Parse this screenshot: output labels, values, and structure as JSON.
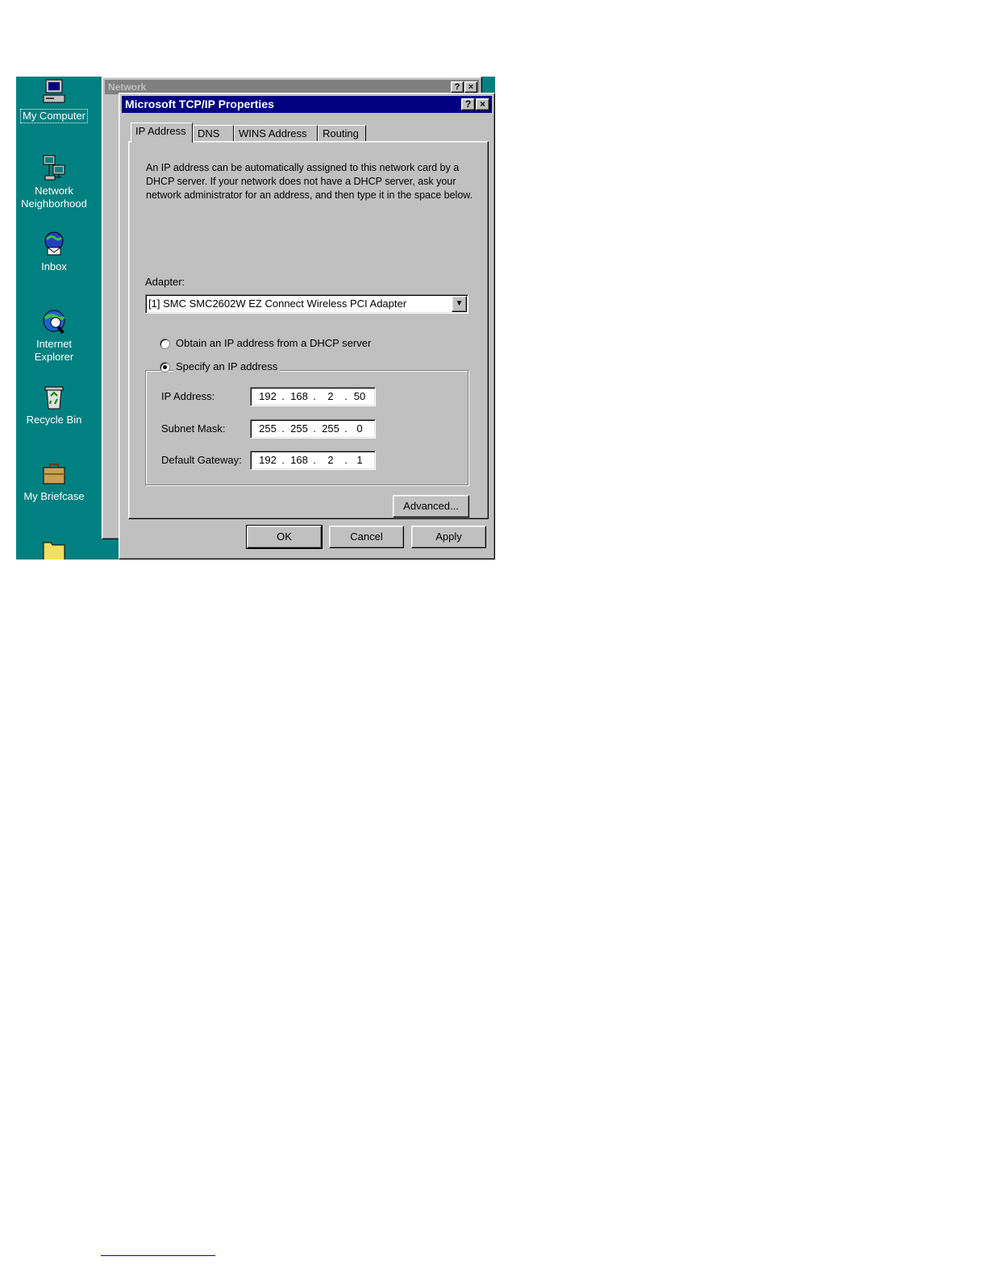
{
  "desktop": {
    "background_color": "#008080",
    "icons": [
      {
        "label": "My Computer",
        "icon": "my-computer-icon"
      },
      {
        "label": "Network Neighborhood",
        "icon": "network-neighborhood-icon"
      },
      {
        "label": "Inbox",
        "icon": "inbox-icon"
      },
      {
        "label": "Internet Explorer",
        "icon": "internet-explorer-icon"
      },
      {
        "label": "Recycle Bin",
        "icon": "recycle-bin-icon"
      },
      {
        "label": "My Briefcase",
        "icon": "briefcase-icon"
      },
      {
        "label": "",
        "icon": "folder-icon"
      }
    ]
  },
  "network_window": {
    "title": "Network",
    "help_button": "?",
    "close_button": "×"
  },
  "dialog": {
    "title": "Microsoft TCP/IP Properties",
    "help_button": "?",
    "close_button": "×",
    "tabs": [
      {
        "label": "IP Address",
        "active": true
      },
      {
        "label": "DNS",
        "active": false
      },
      {
        "label": "WINS Address",
        "active": false
      },
      {
        "label": "Routing",
        "active": false
      }
    ],
    "description": "An IP address can be automatically assigned to this network card by a DHCP server.  If your network does not have a DHCP server, ask your network administrator for an address, and then type it in the space below.",
    "adapter_label": "Adapter:",
    "adapter_value": "[1] SMC SMC2602W EZ Connect Wireless PCI Adapter",
    "radio_obtain": "Obtain an IP address from a DHCP server",
    "radio_specify": "Specify an IP address",
    "selected_option": "specify",
    "ip_address": {
      "label": "IP Address:",
      "octets": [
        "192",
        "168",
        "2",
        "50"
      ]
    },
    "subnet_mask": {
      "label": "Subnet Mask:",
      "octets": [
        "255",
        "255",
        "255",
        "0"
      ]
    },
    "default_gateway": {
      "label": "Default Gateway:",
      "octets": [
        "192",
        "168",
        "2",
        "1"
      ]
    },
    "advanced_button": "Advanced...",
    "ok_button": "OK",
    "cancel_button": "Cancel",
    "apply_button": "Apply"
  }
}
